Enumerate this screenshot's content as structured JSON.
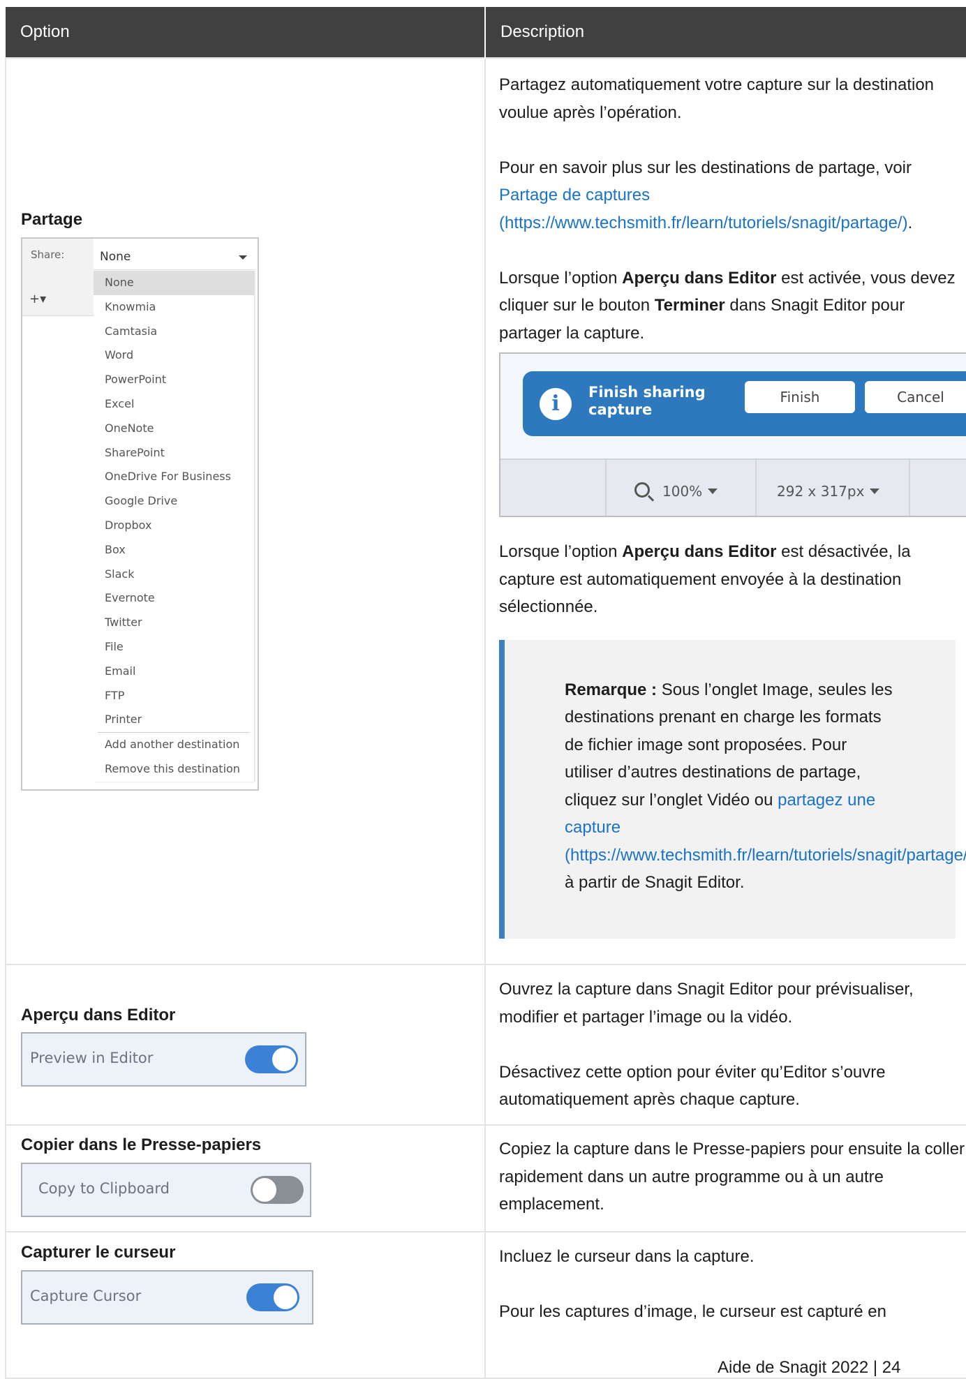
{
  "table": {
    "headers": [
      "Option",
      "Description"
    ]
  },
  "rows": {
    "share": {
      "title": "Partage",
      "ui": {
        "label": "Share:",
        "selected": "None",
        "plus": "+▾",
        "items": [
          "None",
          "Knowmia",
          "Camtasia",
          "Word",
          "PowerPoint",
          "Excel",
          "OneNote",
          "SharePoint",
          "OneDrive For Business",
          "Google Drive",
          "Dropbox",
          "Box",
          "Slack",
          "Evernote",
          "Twitter",
          "File",
          "Email",
          "FTP",
          "Printer"
        ],
        "extra_items": [
          "Add another destination",
          "Remove this destination"
        ]
      },
      "p1": "Partagez automatiquement votre capture sur la destination voulue après l’opération.",
      "p2_text": "Pour en savoir plus sur les destinations de partage, voir ",
      "p2_link": "Partage de captures (https://www.techsmith.fr/learn/tutoriels/snagit/partage/)",
      "p2_end": ".",
      "p3_a": "Lorsque l’option ",
      "p3_b": "Aperçu dans Editor",
      "p3_c": " est activée, vous devez cliquer sur le bouton ",
      "p3_d": "Terminer",
      "p3_e": " dans Snagit Editor pour partager la capture.",
      "finish": {
        "message": "Finish sharing capture",
        "finish_button": "Finish",
        "cancel_button": "Cancel",
        "zoom": "100%",
        "size": "292 x 317px"
      },
      "p4_a": "Lorsque l’option ",
      "p4_b": "Aperçu dans Editor",
      "p4_c": " est désactivée, la capture est automatiquement envoyée à la destination sélectionnée.",
      "note_label": "Remarque :",
      "note_text": " Sous l’onglet Image, seules les destinations prenant en charge les formats de fichier image sont proposées. Pour utiliser d’autres destinations de partage, cliquez sur l’onglet Vidéo ou ",
      "note_link": "partagez une capture (https://www.techsmith.fr/learn/tutoriels/snagit/partage/)",
      "note_end": " à partir de Snagit Editor."
    },
    "preview": {
      "title": "Aperçu dans Editor",
      "toggle_label": "Preview in Editor",
      "toggle_on": true,
      "p1": "Ouvrez la capture dans Snagit Editor pour prévisualiser, modifier et partager l’image ou la vidéo.",
      "p2": "Désactivez cette option pour éviter qu’Editor s’ouvre automatiquement après chaque capture."
    },
    "clipboard": {
      "title": "Copier dans le Presse-papiers",
      "toggle_label": "Copy to Clipboard",
      "toggle_on": false,
      "p1": "Copiez la capture dans le Presse-papiers pour ensuite la coller rapidement dans un autre programme ou à un autre emplacement."
    },
    "cursor": {
      "title": "Capturer le curseur",
      "toggle_label": "Capture Cursor",
      "toggle_on": true,
      "p1": "Incluez le curseur dans la capture.",
      "p2": "Pour les captures d’image, le curseur est capturé en"
    }
  },
  "footer": "Aide de Snagit 2022 | 24",
  "colors": {
    "header_bg": "#404040",
    "link": "#1a73c8",
    "note_bar": "#3b7fc4",
    "toggle_on": "#3b82d6",
    "toggle_off": "#8a8f96",
    "banner": "#2e79bd"
  }
}
